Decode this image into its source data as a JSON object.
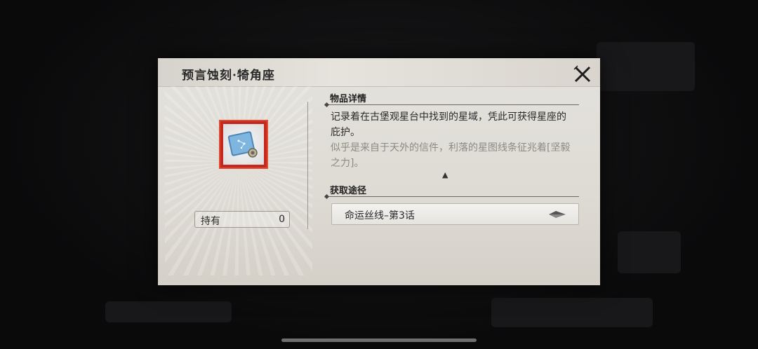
{
  "dialog": {
    "title": "预言蚀刻·犄角座",
    "item_icon": "star-map-scroll-icon",
    "owned": {
      "label": "持有",
      "value": "0"
    },
    "details": {
      "heading": "物品详情",
      "description": "记录着在古堡观星台中找到的星域，凭此可获得星座的庇护。",
      "flavor": "似乎是来自于天外的信件，利落的星图线条征兆着[坚毅之力]。"
    },
    "source": {
      "heading": "获取途径",
      "route_label": "命运丝线–第3话"
    }
  },
  "colors": {
    "dialog_bg": "#e4e2dd",
    "item_frame": "#c4281e",
    "flavor_text": "#8d8a84"
  }
}
